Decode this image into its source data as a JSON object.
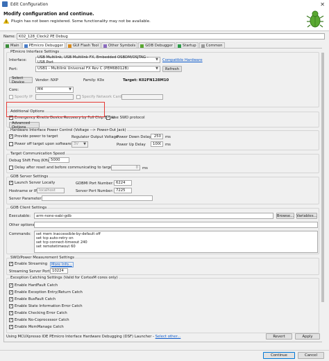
{
  "window": {
    "title": "Edit Configuration",
    "close": "✕"
  },
  "header": {
    "heading": "Modify configuration and continue.",
    "warning": "Plugin has not been registered. Some functionality may not be available."
  },
  "name": {
    "label": "Name:",
    "value": "K02_128_Clock2 PE Debug"
  },
  "tabs": [
    {
      "label": "Main"
    },
    {
      "label": "PEmicro Debugger"
    },
    {
      "label": "GUI Flash Tool"
    },
    {
      "label": "Other Symbols"
    },
    {
      "label": "GDB Debugger"
    },
    {
      "label": "Startup"
    },
    {
      "label": "Common"
    }
  ],
  "pemicro": {
    "group_title": "PEmicro Interface Settings",
    "interface_label": "Interface:",
    "interface_value": "USB Multilink, USB Multilink FX, Embedded OSBDM/OSJTAG - USB Port",
    "compatible_hw": "Compatible Hardware",
    "port_label": "Port:",
    "port_value": "USB1 - Multilink Universal FX Rev C (PEM6B012B)",
    "refresh": "Refresh",
    "select_device": "Select Device",
    "vendor": "Vendor: NXP",
    "family": "Family: K0x",
    "target": "Target: K02FN128M10",
    "core_label": "Core:",
    "core_value": "M4",
    "specify_ip": "Specify IP",
    "specify_ip_value": "",
    "specify_network_card_ip": "Specify Network Card IP",
    "network_card_value": ""
  },
  "additional": {
    "group_title": "Additional Options",
    "emergency_recovery": "Emergency Kinetis Device Recovery by Full Chip Erase",
    "use_swd": "Use SWD protocol",
    "advanced_options": "Advanced Options"
  },
  "power": {
    "group_title": "Hardware Interface Power Control (Voltage --> Power-Out Jack)",
    "provide_power": "Provide power to target",
    "regulator_label": "Regulator Output Voltage",
    "regulator_value": "3V",
    "power_down_label": "Power Down Delay",
    "power_down_value": "250",
    "power_up_label": "Power Up Delay",
    "power_up_value": "1000",
    "ms": "ms",
    "power_off": "Power off target upon software exit"
  },
  "comm": {
    "group_title": "Target Communication Speed",
    "debug_shift_label": "Debug Shift Freq (KHz):",
    "debug_shift_value": "5000",
    "delay_label": "Delay after reset and before communicating to target for",
    "delay_value": "0",
    "ms": "ms"
  },
  "gdb_server": {
    "group_title": "GDB Server Settings",
    "launch_locally": "Launch Server Locally",
    "gdbmi_label": "GDBMI Port Number:",
    "gdbmi_value": "6224",
    "hostname_label": "Hostname or IP:",
    "hostname_value": "localhost",
    "server_port_label": "Server Port Number:",
    "server_port_value": "7225",
    "server_params_label": "Server Parameters:",
    "server_params_value": ""
  },
  "gdb_client": {
    "group_title": "GDB Client Settings",
    "executable_label": "Executable:",
    "executable_value": "arm-none-eabi-gdb",
    "browse": "Browse...",
    "variables": "Variables...",
    "other_options_label": "Other options:",
    "other_options_value": "",
    "commands_label": "Commands:",
    "commands": [
      "set mem inaccessible-by-default off",
      "set tcp auto-retry on",
      "set tcp connect-timeout 240",
      "set remotetimeout 60"
    ]
  },
  "swo": {
    "group_title": "SWO/Power Measurement Settings",
    "enable_streaming": "Enable Streaming",
    "more_info": "More Info...",
    "port_label": "Streaming Server Port:",
    "port_value": "10224"
  },
  "exceptions": {
    "group_title": "Exception Catching Settings (Valid for CortexM cores only)",
    "items": [
      "Enable HardFault Catch",
      "Enable Exception Entry/Return Catch",
      "Enable BusFault Catch",
      "Enable State Information Error Catch",
      "Enable Checking Error Catch",
      "Enable No-Coprocessor Catch",
      "Enable MemManage Catch"
    ]
  },
  "footer": {
    "launcher_text": "Using MCUXpresso IDE PEmicro Interface Hardware Debugging (DSF) Launcher -",
    "select_other": "Select other...",
    "revert": "Revert",
    "apply": "Apply",
    "continue": "Continue",
    "cancel": "Cancel"
  },
  "colors": {
    "highlight": "#e53935",
    "link": "#0a58ca",
    "accent": "#0078d7"
  }
}
